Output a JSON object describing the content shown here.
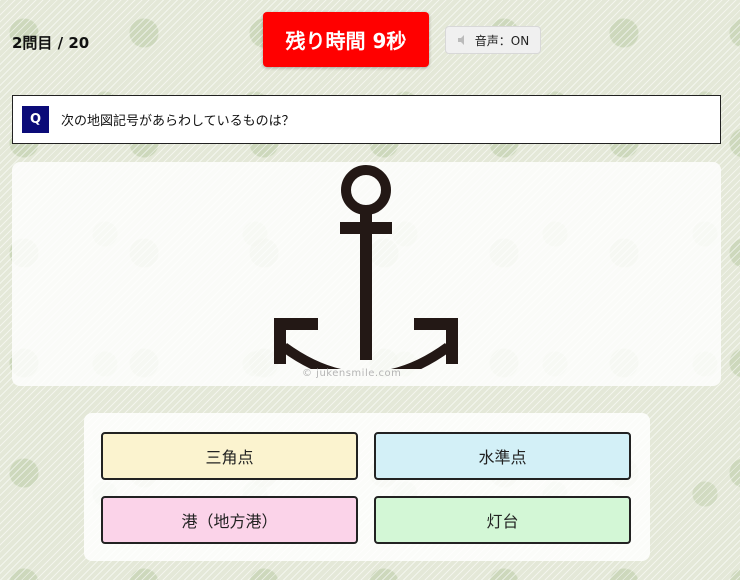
{
  "header": {
    "counter": "2問目 / 20",
    "timer": "残り時間 9秒",
    "sound_label": "音声：ON",
    "sound_icon": "speaker-icon"
  },
  "question": {
    "badge": "Q",
    "text": "次の地図記号があらわしているものは？"
  },
  "image": {
    "symbol_icon": "anchor-icon",
    "watermark": "© jukensmile.com"
  },
  "choices": [
    {
      "label": "三角点",
      "color": "#fbf3cf"
    },
    {
      "label": "水準点",
      "color": "#d3f0f7"
    },
    {
      "label": "港（地方港）",
      "color": "#fbd3e9"
    },
    {
      "label": "灯台",
      "color": "#d3f7d6"
    }
  ],
  "colors": {
    "timer_bg": "#ff0000",
    "q_badge_bg": "#0b0b78"
  }
}
